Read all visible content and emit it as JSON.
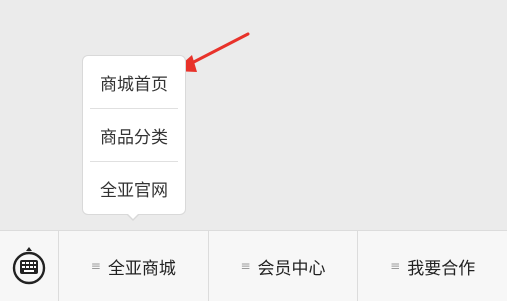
{
  "popup_menu": {
    "items": [
      {
        "label": "商城首页"
      },
      {
        "label": "商品分类"
      },
      {
        "label": "全亚官网"
      }
    ]
  },
  "tabbar": {
    "keyboard_icon": "keyboard-icon",
    "tabs": [
      {
        "label": "全亚商城",
        "icon": "menu-lines-icon"
      },
      {
        "label": "会员中心",
        "icon": "menu-lines-icon"
      },
      {
        "label": "我要合作",
        "icon": "menu-lines-icon"
      }
    ]
  },
  "colors": {
    "annotation_arrow": "#e8322a",
    "background": "#ebebeb",
    "tabbar_bg": "#f7f7f7"
  }
}
